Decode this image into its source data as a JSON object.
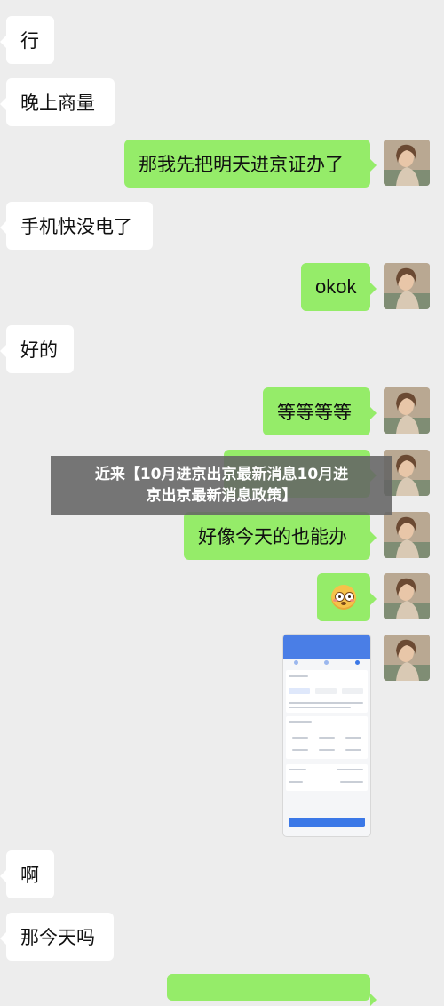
{
  "messages": [
    {
      "side": "left",
      "text": "行"
    },
    {
      "side": "left",
      "text": "晚上商量"
    },
    {
      "side": "right",
      "text": "那我先把明天进京证办了"
    },
    {
      "side": "left",
      "text": "手机快没电了"
    },
    {
      "side": "right",
      "text": "okok"
    },
    {
      "side": "left",
      "text": "好的"
    },
    {
      "side": "right",
      "text": "等等等等"
    },
    {
      "side": "right",
      "text": "好像今天的也能办"
    },
    {
      "side": "right",
      "emoji": "flushed-face-icon"
    },
    {
      "side": "right",
      "image": "phone-screenshot"
    },
    {
      "side": "left",
      "text": "啊"
    },
    {
      "side": "left",
      "text": "那今天吗"
    }
  ],
  "overlay": {
    "headline_line1": "近来【10月进京出京最新消息10月进",
    "headline_line2": "京出京最新消息政策】"
  },
  "colors": {
    "background": "#ededed",
    "left_bubble": "#ffffff",
    "right_bubble": "#95ec69",
    "overlay": "#646464"
  }
}
